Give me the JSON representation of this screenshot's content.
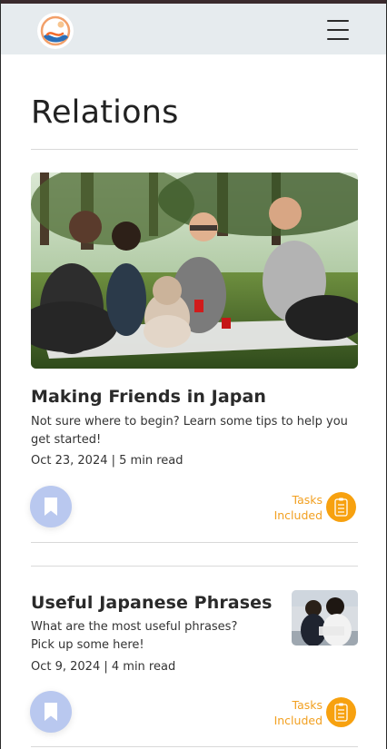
{
  "page": {
    "title": "Relations"
  },
  "articles": [
    {
      "title": "Making Friends in Japan",
      "description": "Not sure where to begin? Learn some tips to help you get started!",
      "meta": "Oct 23, 2024 | 5 min read",
      "tasks_line1": "Tasks",
      "tasks_line2": "Included",
      "image_icon": "group-picnic-photo"
    },
    {
      "title": "Useful Japanese Phrases",
      "description_line1": "What are the most useful phrases?",
      "description_line2": "Pick up some here!",
      "meta": "Oct 9, 2024 | 4 min read",
      "tasks_line1": "Tasks",
      "tasks_line2": "Included",
      "image_icon": "office-colleagues-photo"
    }
  ],
  "icons": {
    "menu": "hamburger-menu-icon",
    "logo": "brand-logo-icon",
    "bookmark": "bookmark-icon",
    "tasks": "tasks-checklist-icon"
  },
  "colors": {
    "header_bg": "#e6ebee",
    "bookmark_bg": "#b9c8ef",
    "tasks_accent": "#f7a10f",
    "text_primary": "#2a2a2a",
    "divider": "#d9d9d9"
  }
}
